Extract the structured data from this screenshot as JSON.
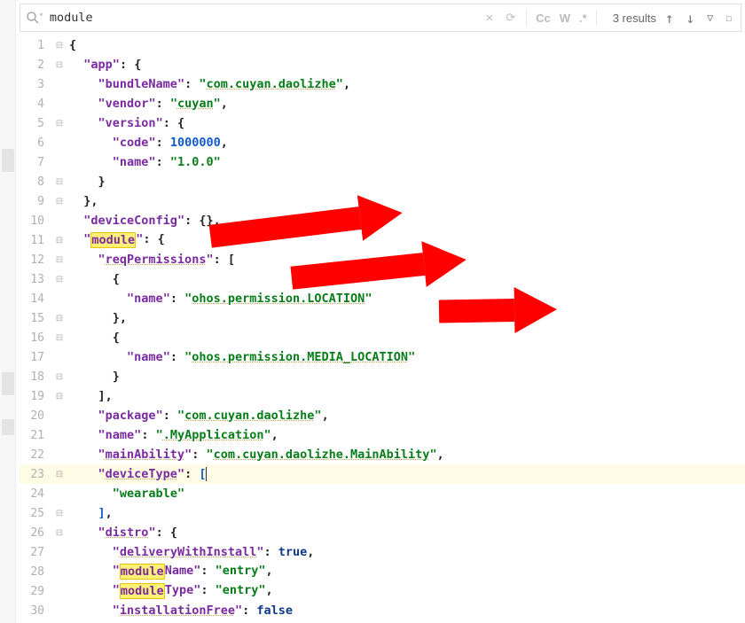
{
  "search": {
    "term": "module",
    "results": "3 results",
    "cc": "Cc",
    "w": "W",
    "regex": ".*"
  },
  "ln": [
    "1",
    "2",
    "3",
    "4",
    "5",
    "6",
    "7",
    "8",
    "9",
    "10",
    "11",
    "12",
    "13",
    "14",
    "15",
    "16",
    "17",
    "18",
    "19",
    "20",
    "21",
    "22",
    "23",
    "24",
    "25",
    "26",
    "27",
    "28",
    "29",
    "30"
  ],
  "j": {
    "app": "app",
    "bundleNameK": "bundleName",
    "bundleNameV": "com.cuyan.daolizhe",
    "vendorK": "vendor",
    "vendorV": "cuyan",
    "versionK": "version",
    "codeK": "code",
    "codeV": "1000000",
    "versionNameK": "name",
    "versionNameV": "1.0.0",
    "deviceConfigK": "deviceConfig",
    "moduleK": "module",
    "reqPermissionsK": "reqPermissions",
    "permNameK1": "name",
    "permNameV1": "ohos.permission.LOCATION",
    "permNameK2": "name",
    "permNameV2": "ohos.permission.MEDIA_LOCATION",
    "packageK": "package",
    "packageV": "com.cuyan.daolizhe",
    "moduleNameK": "name",
    "moduleNameV": ".MyApplication",
    "mainAbilityK": "mainAbility",
    "mainAbilityV": "com.cuyan.daolizhe.MainAbility",
    "deviceTypeK": "deviceType",
    "wearable": "wearable",
    "distroK": "distro",
    "deliveryK": "deliveryWithInstall",
    "trueV": "true",
    "moduleNameK2": "Name",
    "moduleNameV2": "entry",
    "moduleTypeK2": "Type",
    "moduleTypeV2": "entry",
    "installationFreeK": "installationFree",
    "falseV": "false"
  }
}
